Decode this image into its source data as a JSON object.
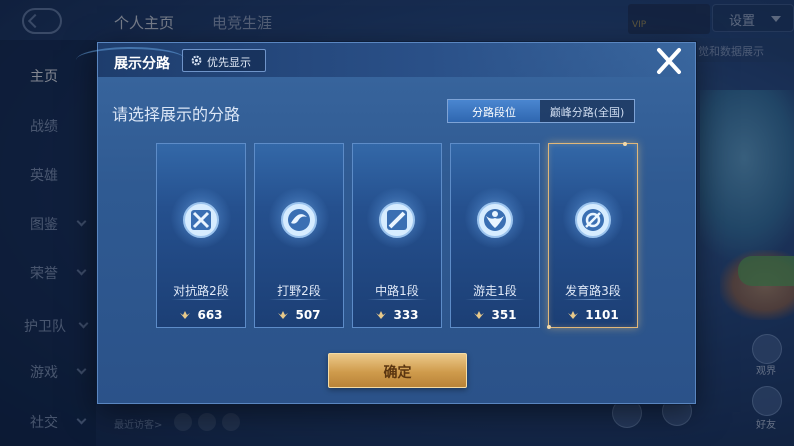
{
  "top_tabs": [
    {
      "label": "个人主页",
      "active": true
    },
    {
      "label": "电竞生涯",
      "active": false
    }
  ],
  "settings_label": "设置",
  "vip_label": "VIP",
  "data_show_label": "觉和数据展示",
  "sidebar": {
    "items": [
      {
        "label": "主页",
        "active": true
      },
      {
        "label": "战绩"
      },
      {
        "label": "英雄"
      },
      {
        "label": "图鉴"
      },
      {
        "label": "荣誉"
      },
      {
        "label": "护卫队"
      },
      {
        "label": "游戏"
      },
      {
        "label": "社交"
      }
    ]
  },
  "recent_visitors_label": "最近访客>",
  "right_labels": {
    "a": "观界",
    "b": "好友"
  },
  "modal": {
    "title": "展示分路",
    "priority_label": "优先显示",
    "prompt": "请选择展示的分路",
    "toggle": {
      "options": [
        "分路段位",
        "巅峰分路(全国)"
      ],
      "selected": 0
    },
    "confirm_label": "确定",
    "lanes": [
      {
        "name": "对抗路2段",
        "score": "663",
        "selected": false,
        "emblem": "sword-shield-icon"
      },
      {
        "name": "打野2段",
        "score": "507",
        "selected": false,
        "emblem": "claw-swirl-icon"
      },
      {
        "name": "中路1段",
        "score": "333",
        "selected": false,
        "emblem": "blade-slash-icon"
      },
      {
        "name": "游走1段",
        "score": "351",
        "selected": false,
        "emblem": "guard-wings-icon"
      },
      {
        "name": "发育路3段",
        "score": "1101",
        "selected": true,
        "emblem": "arrow-ring-icon"
      }
    ]
  },
  "colors": {
    "accent_gold": "#e0b77a",
    "modal_blue": "#2f5a92",
    "toggle_on": "#3d77c0"
  }
}
